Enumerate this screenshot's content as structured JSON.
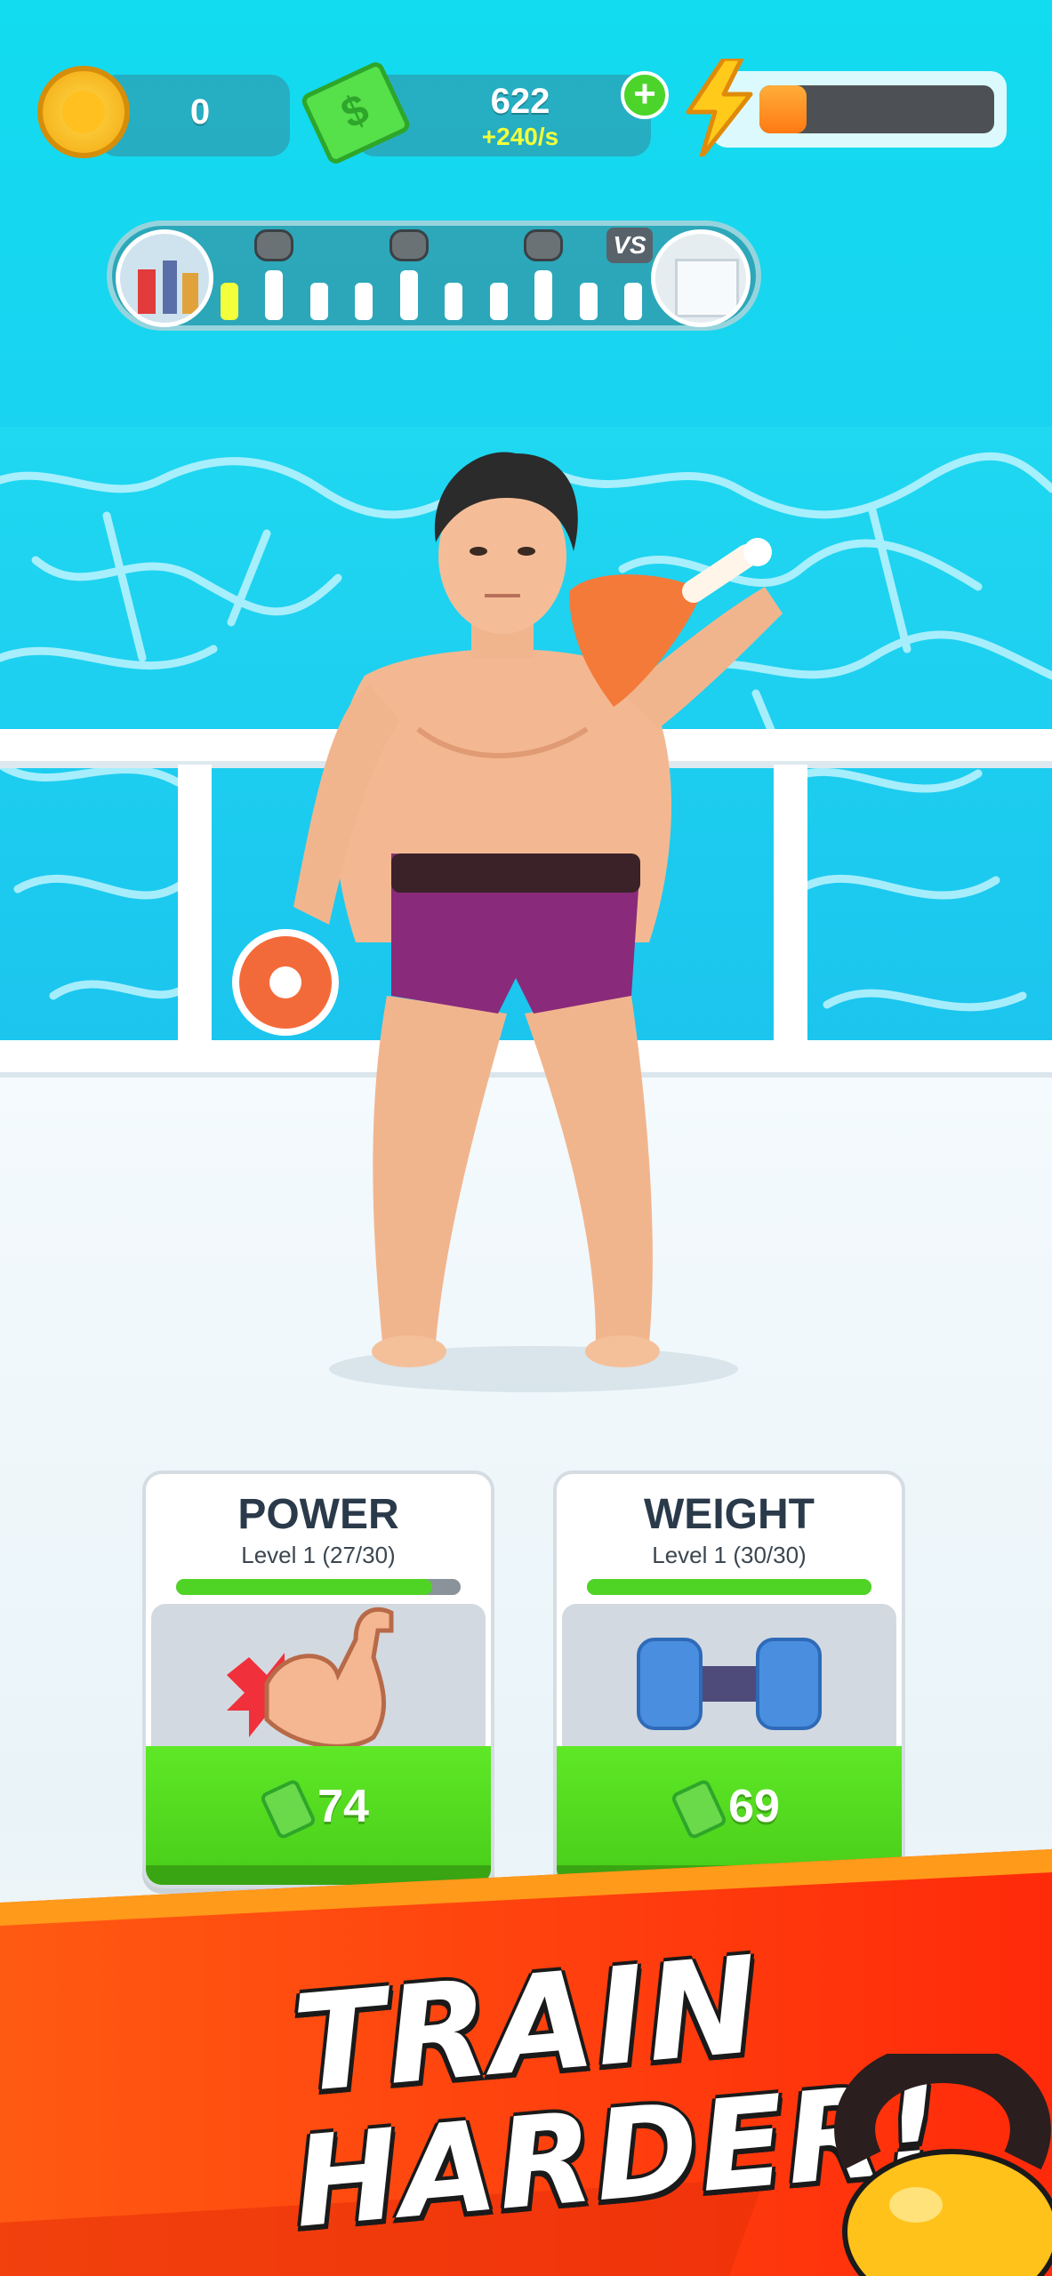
{
  "hud": {
    "coins": "0",
    "cash": "622",
    "cash_rate": "+240/s",
    "energy_level": 0.2
  },
  "progress": {
    "vs_label": "VS",
    "current_step": 1,
    "total_steps": 10
  },
  "cards": [
    {
      "title": "POWER",
      "level": "Level 1 (27/30)",
      "progress": 0.9,
      "price": "74",
      "icon": "flexed-bicep-icon"
    },
    {
      "title": "WEIGHT",
      "level": "Level 1 (30/30)",
      "progress": 1.0,
      "price": "69",
      "icon": "dumbbell-icon"
    }
  ],
  "banner": {
    "line1": "TRAIN",
    "line2": "HARDER!"
  },
  "colors": {
    "accent_green": "#4fd426",
    "banner_orange": "#ff3a10",
    "energy_orange": "#ff8a1a"
  }
}
